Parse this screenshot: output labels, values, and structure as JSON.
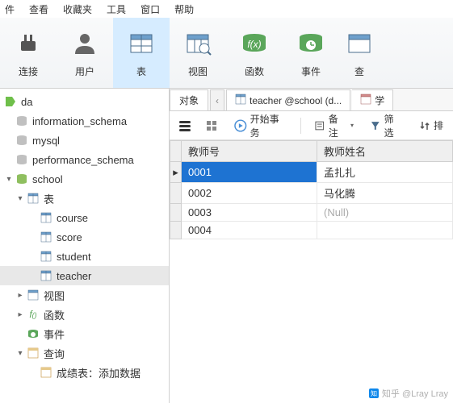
{
  "menu": [
    "件",
    "查看",
    "收藏夹",
    "工具",
    "窗口",
    "帮助"
  ],
  "ribbon": [
    {
      "label": "连接",
      "icon": "plug-icon"
    },
    {
      "label": "用户",
      "icon": "user-icon"
    },
    {
      "label": "表",
      "icon": "table-icon",
      "active": true
    },
    {
      "label": "视图",
      "icon": "view-icon"
    },
    {
      "label": "函数",
      "icon": "fx-icon"
    },
    {
      "label": "事件",
      "icon": "event-icon"
    },
    {
      "label": "查",
      "icon": "query-icon"
    }
  ],
  "tree": {
    "connection": "da",
    "databases": [
      "information_schema",
      "mysql",
      "performance_schema"
    ],
    "active_db": "school",
    "tables_group": "表",
    "tables": [
      "course",
      "score",
      "student",
      "teacher"
    ],
    "views": "视图",
    "functions": "函数",
    "events": "事件",
    "queries": "查询",
    "query_item": "成绩表：添加数据"
  },
  "tabs": {
    "obj": "对象",
    "main": "teacher @school (d...",
    "second": "学"
  },
  "subtool": {
    "begin_tx": "开始事务",
    "note": "备注",
    "filter": "筛选",
    "sort": "排"
  },
  "grid": {
    "columns": [
      "教师号",
      "教师姓名"
    ],
    "rows": [
      {
        "id": "0001",
        "name": "孟扎扎",
        "selected": true
      },
      {
        "id": "0002",
        "name": "马化腾"
      },
      {
        "id": "0003",
        "name": "(Null)",
        "null": true
      },
      {
        "id": "0004",
        "name": ""
      }
    ]
  },
  "watermark": "知乎 @Lray Lray"
}
